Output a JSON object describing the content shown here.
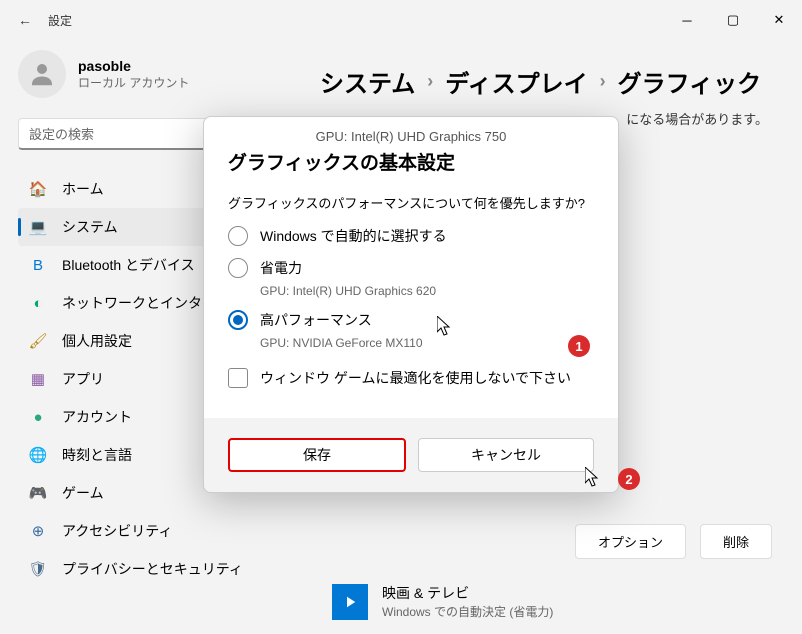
{
  "window": {
    "title": "設定"
  },
  "user": {
    "name": "pasoble",
    "sub": "ローカル アカウント"
  },
  "search": {
    "placeholder": "設定の検索"
  },
  "nav": [
    {
      "label": "ホーム",
      "icon": "🏠",
      "color": "#d08050"
    },
    {
      "label": "システム",
      "icon": "💻",
      "color": "#5a7a99",
      "active": true
    },
    {
      "label": "Bluetooth とデバイス",
      "icon": "B",
      "color": "#0078d4"
    },
    {
      "label": "ネットワークとインターネット",
      "icon": "◐",
      "color": "#00a86b"
    },
    {
      "label": "個人用設定",
      "icon": "🖌",
      "color": "#b8860b"
    },
    {
      "label": "アプリ",
      "icon": "▦",
      "color": "#8a5aa3"
    },
    {
      "label": "アカウント",
      "icon": "●",
      "color": "#2aa87a"
    },
    {
      "label": "時刻と言語",
      "icon": "🌐",
      "color": "#4a90c0"
    },
    {
      "label": "ゲーム",
      "icon": "🎮",
      "color": "#888"
    },
    {
      "label": "アクセシビリティ",
      "icon": "⊕",
      "color": "#3a6ea5"
    },
    {
      "label": "プライバシーとセキュリティ",
      "icon": "🛡",
      "color": "#4a6a8a"
    }
  ],
  "breadcrumb": {
    "a": "システム",
    "sep": "›",
    "b": "ディスプレイ",
    "c": "グラフィック"
  },
  "note_tail": "になる場合があります。",
  "bottom_buttons": {
    "options": "オプション",
    "delete": "削除"
  },
  "app": {
    "name": "映画 & テレビ",
    "sub": "Windows での自動決定 (省電力)"
  },
  "dialog": {
    "gpu_top": "GPU: Intel(R) UHD Graphics 750",
    "title": "グラフィックスの基本設定",
    "question": "グラフィックスのパフォーマンスについて何を優先しますか?",
    "opt1": "Windows で自動的に選択する",
    "opt2": "省電力",
    "opt2_sub": "GPU: Intel(R) UHD Graphics 620",
    "opt3": "高パフォーマンス",
    "opt3_sub": "GPU: NVIDIA GeForce MX110",
    "checkbox": "ウィンドウ ゲームに最適化を使用しないで下さい",
    "save": "保存",
    "cancel": "キャンセル"
  },
  "badges": {
    "b1": "1",
    "b2": "2"
  }
}
